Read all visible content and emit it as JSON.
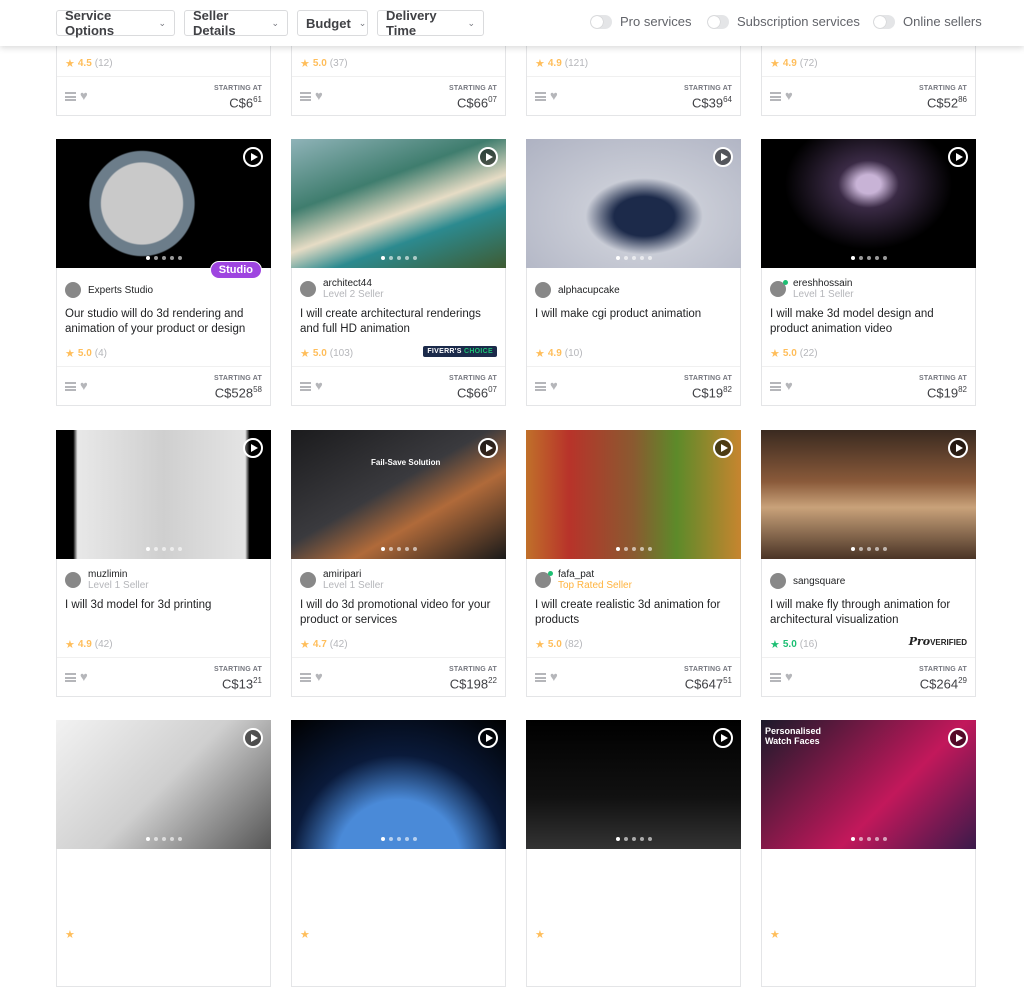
{
  "filters": {
    "buttons": [
      "Service Options",
      "Seller Details",
      "Budget",
      "Delivery Time"
    ],
    "toggles": [
      {
        "label": "Pro services",
        "on": false
      },
      {
        "label": "Subscription services",
        "on": false
      },
      {
        "label": "Online sellers",
        "on": false
      }
    ]
  },
  "starting_at": "STARTING AT",
  "gigs": [
    {
      "rating": "4.5",
      "count": "(12)",
      "price": "C$6",
      "cents": "61"
    },
    {
      "rating": "5.0",
      "count": "(37)",
      "price": "C$66",
      "cents": "07"
    },
    {
      "rating": "4.9",
      "count": "(121)",
      "price": "C$39",
      "cents": "64"
    },
    {
      "rating": "4.9",
      "count": "(72)",
      "price": "C$52",
      "cents": "86"
    },
    {
      "seller": "Experts Studio",
      "title": "Our studio will do 3d rendering and animation of your product or design",
      "rating": "5.0",
      "count": "(4)",
      "price": "C$528",
      "cents": "58",
      "badge": "Studio",
      "img": "radial-gradient(circle at 40% 50%,#c9c9c9 0 28%,#6c7d8a 29% 36%,#000 37%)"
    },
    {
      "seller": "architect44",
      "level": "Level 2 Seller",
      "title": "I will create architectural renderings and full HD animation",
      "rating": "5.0",
      "count": "(103)",
      "price": "C$66",
      "cents": "07",
      "fiverr_choice": [
        "FIVERR'S ",
        "CHOICE"
      ],
      "img": "linear-gradient(160deg,#8fb3b8 0%,#3f7d6e 35%,#e6dcc5 55%,#2c8a8f 70%,#3e5b32 100%)"
    },
    {
      "seller": "alphacupcake",
      "title": "I will make cgi product animation",
      "rating": "4.9",
      "count": "(10)",
      "price": "C$19",
      "cents": "82",
      "img": "radial-gradient(ellipse at 55% 60%,#1c2a4a 0 18%,#c9ccd6 35%,#aeb2c2 100%)"
    },
    {
      "seller": "ereshhossain",
      "level": "Level 1 Seller",
      "online": true,
      "title": "I will make 3d model design and product animation video",
      "rating": "5.0",
      "count": "(22)",
      "price": "C$19",
      "cents": "82",
      "img": "radial-gradient(ellipse at 50% 35%,#c8b3d6 0 8%,#3a2a45 20%,#000 55%)"
    },
    {
      "seller": "muzlimin",
      "level": "Level 1 Seller",
      "title": "I will 3d model for 3d printing",
      "rating": "4.9",
      "count": "(42)",
      "price": "C$13",
      "cents": "21",
      "img": "linear-gradient(90deg,#000 0 8%,#e8e8e8 10%,#cfcfcf 50%,#e4e4e4 88%,#000 90%)"
    },
    {
      "seller": "amiripari",
      "level": "Level 1 Seller",
      "title": "I will do 3d promotional video for your product or services",
      "rating": "4.7",
      "count": "(42)",
      "price": "C$198",
      "cents": "22",
      "overlay": "Fail-Save Solution",
      "img": "linear-gradient(150deg,#1b1b1d 0%,#3a3a3e 45%,#b06a3a 65%,#1a1a1a 100%)"
    },
    {
      "seller": "fafa_pat",
      "level": "Top Rated Seller",
      "top": true,
      "online": true,
      "title": "I will create realistic 3d animation for products",
      "rating": "5.0",
      "count": "(82)",
      "price": "C$647",
      "cents": "51",
      "img": "linear-gradient(90deg,#c0702a 0%,#b8332a 20%,#8a5a30 50%,#5d8a2a 70%,#c7852f 100%)"
    },
    {
      "seller": "sangsquare",
      "title": "I will make fly through animation for architectural visualization",
      "rating": "5.0",
      "count": "(16)",
      "price": "C$264",
      "cents": "29",
      "pro": [
        "Pro",
        "VERIFIED"
      ],
      "rating_color": "#1dbf73",
      "img": "linear-gradient(180deg,#3a2a20 0%,#8a5a3a 40%,#c9a27a 60%,#4a3426 100%)"
    },
    {
      "img": "linear-gradient(135deg,#f2f2f2,#cfcfcf 50%,#555)"
    },
    {
      "img": "radial-gradient(circle at 50% 110%,#4a8ad8 0 35%,#0a1a3a 60%,#000)"
    },
    {
      "img": "linear-gradient(180deg,#000,#111 60%,#333)"
    },
    {
      "overlay": "Personalised Watch Faces",
      "img": "linear-gradient(135deg,#1a1a2a,#c2185b 60%,#3a1a4a)"
    }
  ],
  "colors": {
    "star": "#ffbe5b",
    "accent": "#1dbf73",
    "studio": "#9e45e0"
  }
}
